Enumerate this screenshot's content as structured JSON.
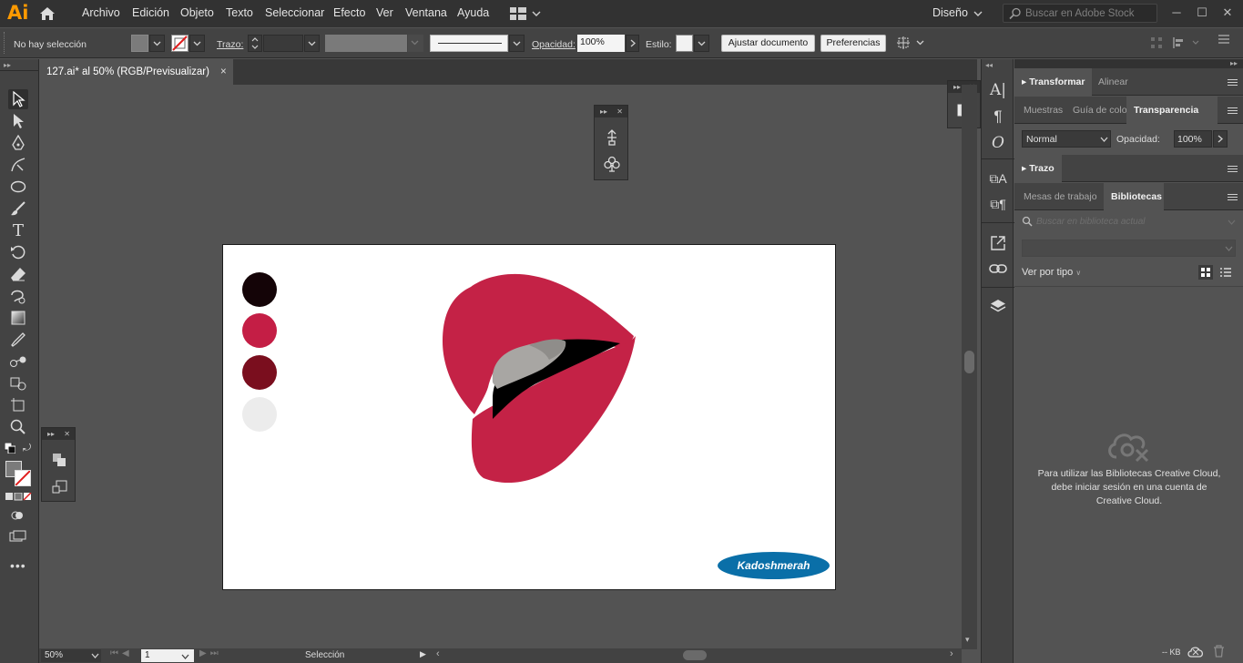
{
  "app": {
    "logo": "Ai"
  },
  "menu": [
    "Archivo",
    "Edición",
    "Objeto",
    "Texto",
    "Seleccionar",
    "Efecto",
    "Ver",
    "Ventana",
    "Ayuda"
  ],
  "workspace": {
    "label": "Diseño"
  },
  "stock_search": {
    "placeholder": "Buscar en Adobe Stock"
  },
  "controlbar": {
    "selection_status": "No hay selección",
    "stroke_label": "Trazo:",
    "opacity_label": "Opacidad:",
    "opacity_value": "100%",
    "style_label": "Estilo:",
    "fit_document_button": "Ajustar documento",
    "preferences_button": "Preferencias"
  },
  "document_tab": {
    "title": "127.ai* al 50% (RGB/Previsualizar)",
    "close": "×"
  },
  "artboard": {
    "swatches": [
      "#140407",
      "#c41e45",
      "#7a0e1e",
      "#ececec"
    ],
    "watermark": "Kadoshmerah",
    "colors": {
      "lip": "#c42246",
      "mouth": "#000000",
      "teeth": "#a8a6a3"
    }
  },
  "status": {
    "zoom": "50%",
    "artboard_number": "1",
    "tool_name": "Selección"
  },
  "panels": {
    "transform_tabs": [
      "Transformar",
      "Alinear"
    ],
    "color_tabs": [
      "Muestras",
      "Guía de colo",
      "Transparencia"
    ],
    "blend_mode": "Normal",
    "opacity_label": "Opacidad:",
    "opacity_value": "100%",
    "stroke_title": "Trazo",
    "library_tabs": [
      "Mesas de trabajo",
      "Bibliotecas"
    ],
    "library_search_placeholder": "Buscar en biblioteca actual",
    "view_by_type": "Ver por tipo",
    "library_message": "Para utilizar las Bibliotecas Creative Cloud, debe iniciar sesión en una cuenta de Creative Cloud.",
    "kb_label": "-- KB"
  }
}
